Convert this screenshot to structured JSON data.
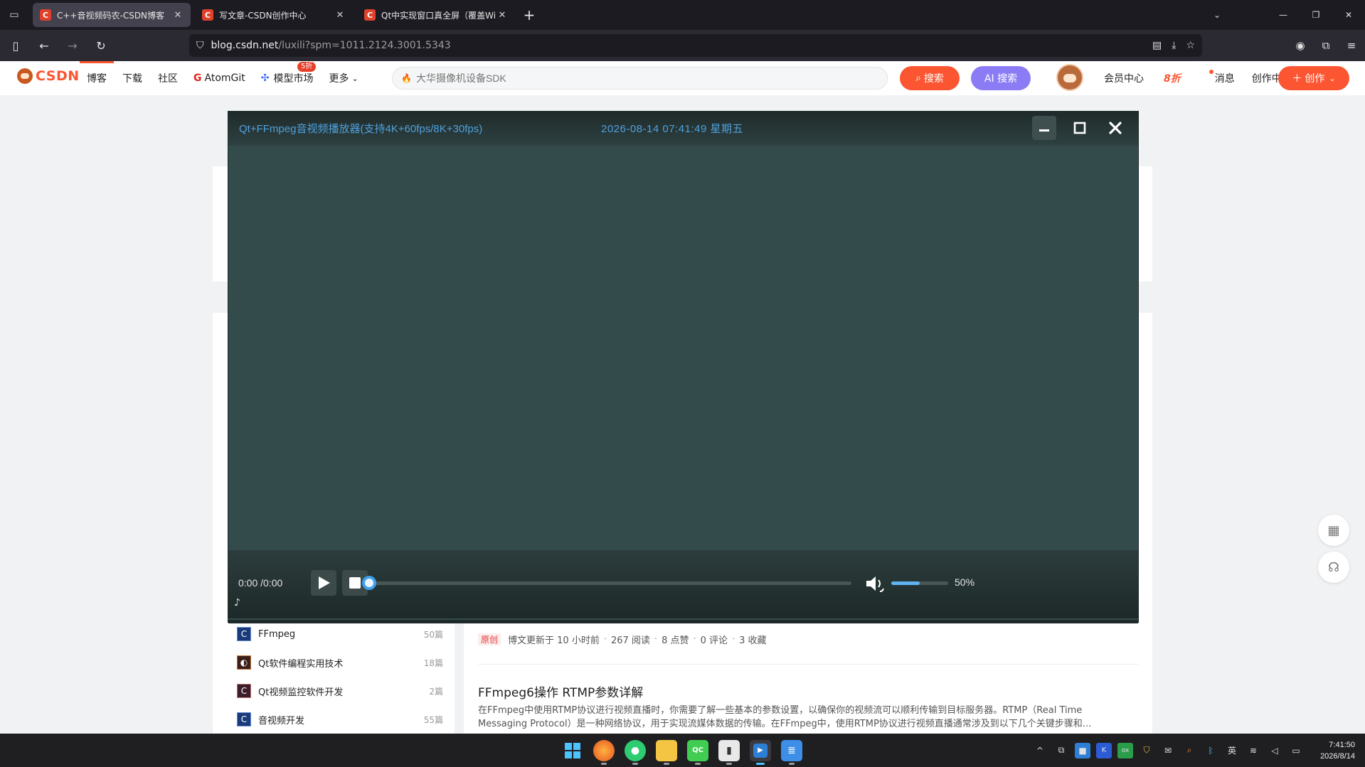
{
  "browser": {
    "tabs": [
      {
        "title": "C++音视频码农-CSDN博客",
        "active": true
      },
      {
        "title": "写文章-CSDN创作中心",
        "active": false
      },
      {
        "title": "Qt中实现窗口真全屏（覆盖Wir",
        "active": false
      }
    ],
    "url_domain": "blog.csdn.net",
    "url_path": "/luxili?spm=1011.2124.3001.5343"
  },
  "csdn": {
    "logo": "CSDN",
    "nav": [
      "博客",
      "下载",
      "社区",
      "AtomGit",
      "模型市场",
      "更多"
    ],
    "nav_atom_prefix": "G",
    "model_badge": "5折",
    "search_placeholder": "大华摄像机设备SDK",
    "search_btn": "搜索",
    "ai_btn": "AI 搜索",
    "vip": "会员中心",
    "vip_sale": "8折",
    "messages": "消息",
    "creator": "创作中心",
    "create_btn": "创作"
  },
  "player": {
    "title": "Qt+FFmpeg音视频播放器(支持4K+60fps/8K+30fps)",
    "clock": "2026-08-14 07:41:49 星期五",
    "time_display": "0:00 /0:00",
    "seek_progress": 0,
    "volume_percent": 50,
    "volume_label": "50%",
    "note_symbol": "♪",
    "colors": {
      "accent": "#3fa0ec",
      "title": "#4ea1dd",
      "video_bg": "#344b4b"
    }
  },
  "blog": {
    "categories": [
      {
        "name": "FFmpeg",
        "count": "50篇"
      },
      {
        "name": "Qt软件编程实用技术",
        "count": "18篇"
      },
      {
        "name": "Qt视频监控软件开发",
        "count": "2篇"
      },
      {
        "name": "音视频开发",
        "count": "55篇"
      }
    ],
    "meta": {
      "original": "原创",
      "updated": "博文更新于 10 小时前",
      "reads": "267 阅读",
      "likes": "8 点赞",
      "comments": "0 评论",
      "favorites": "3 收藏"
    },
    "article_title": "FFmpeg6操作 RTMP参数详解",
    "article_desc": "在FFmpeg中使用RTMP协议进行视频直播时，你需要了解一些基本的参数设置，以确保你的视频流可以顺利传输到目标服务器。RTMP（Real Time Messaging Protocol）是一种网络协议，用于实现流媒体数据的传输。在FFmpeg中，使用RTMP协议进行视频直播通常涉及到以下几个关键步骤和..."
  },
  "taskbar": {
    "time": "7:41:50",
    "date": "2026/8/14",
    "ime": "英"
  }
}
